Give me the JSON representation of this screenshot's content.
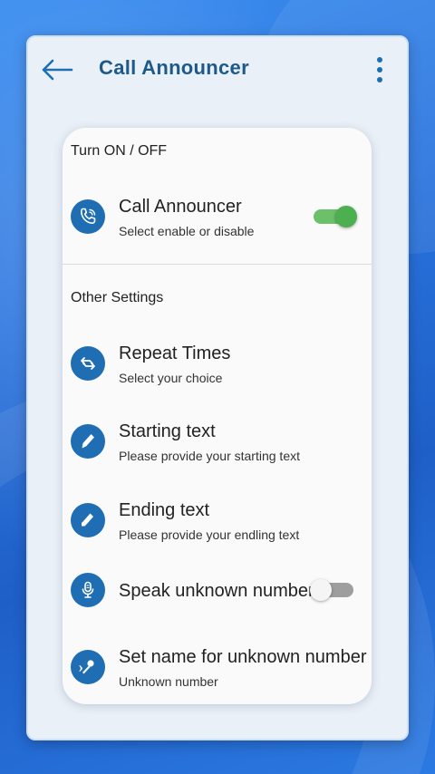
{
  "appbar": {
    "title": "Call Announcer"
  },
  "sections": {
    "turn_on_off": "Turn ON / OFF",
    "other_settings": "Other Settings"
  },
  "items": {
    "call_announcer": {
      "title": "Call Announcer",
      "subtitle": "Select enable or disable",
      "enabled": true,
      "icon": "phone-ring-icon"
    },
    "repeat_times": {
      "title": "Repeat Times",
      "subtitle": "Select your choice",
      "icon": "repeat-icon"
    },
    "starting_text": {
      "title": "Starting text",
      "subtitle": "Please provide your starting text",
      "icon": "pen-icon"
    },
    "ending_text": {
      "title": "Ending text",
      "subtitle": "Please provide your endling text",
      "icon": "marker-icon"
    },
    "speak_unknown": {
      "title": "Speak unknown number",
      "enabled": false,
      "icon": "microphone-icon"
    },
    "set_name_unknown": {
      "title": "Set name for unknown number",
      "subtitle": "Unknown number",
      "icon": "mic-wave-icon"
    }
  },
  "colors": {
    "accent": "#1f6db3",
    "title": "#1d5a8a",
    "toggle_on": "#4caf50",
    "toggle_off": "#9e9e9e"
  }
}
